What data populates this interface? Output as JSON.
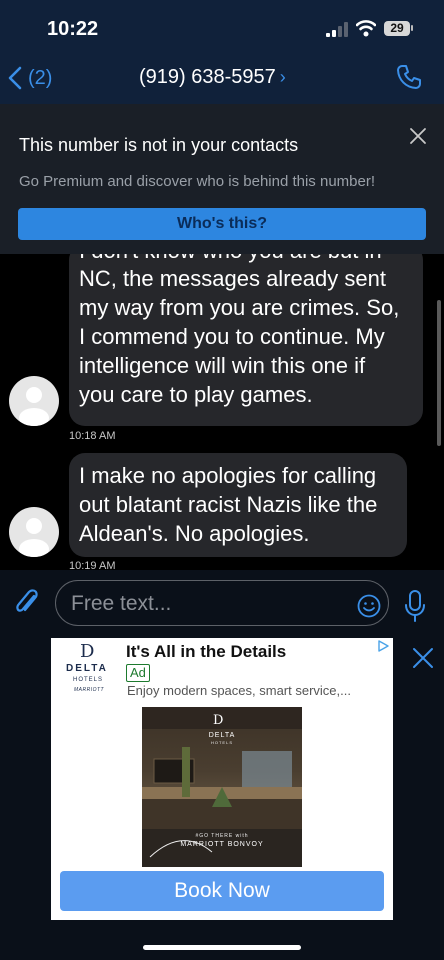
{
  "status_bar": {
    "time": "10:22",
    "battery": "29"
  },
  "nav": {
    "back_label": "(2)",
    "title": "(919) 638-5957",
    "title_chevron": "›"
  },
  "banner": {
    "title": "This number is not in your contacts",
    "subtitle": "Go Premium and discover who is behind this number!",
    "button_label": "Who's this?"
  },
  "messages": [
    {
      "partial_top": "I don't know who you are but in",
      "lines": [
        "NC, the messages already sent",
        "my way from you are crimes. So,",
        "I commend you to continue. My",
        "intelligence will win this one if",
        "you care to play games."
      ],
      "time": "10:18 AM"
    },
    {
      "lines": [
        "I make no apologies for calling",
        "out blatant racist Nazis like the",
        "Aldean's. No apologies."
      ],
      "time": "10:19 AM"
    }
  ],
  "input": {
    "placeholder": "Free text..."
  },
  "ad": {
    "logo_d": "D",
    "logo_delta": "DELTA",
    "logo_hotels": "HOTELS",
    "logo_marriott": "MARRIOTT",
    "headline": "It's All in the Details",
    "badge": "Ad",
    "description": "Enjoy modern spaces, smart service,...",
    "image_d": "D",
    "image_delta": "DELTA",
    "image_hotels": "HOTELS",
    "image_go": "#GO THERE with",
    "image_bonvoy": "MARRIOTT BONVOY",
    "cta": "Book Now"
  },
  "colors": {
    "accent": "#3a8fe8",
    "header_bg": "#10213a",
    "bubble": "#26272b",
    "cta": "#5b9cf0"
  }
}
